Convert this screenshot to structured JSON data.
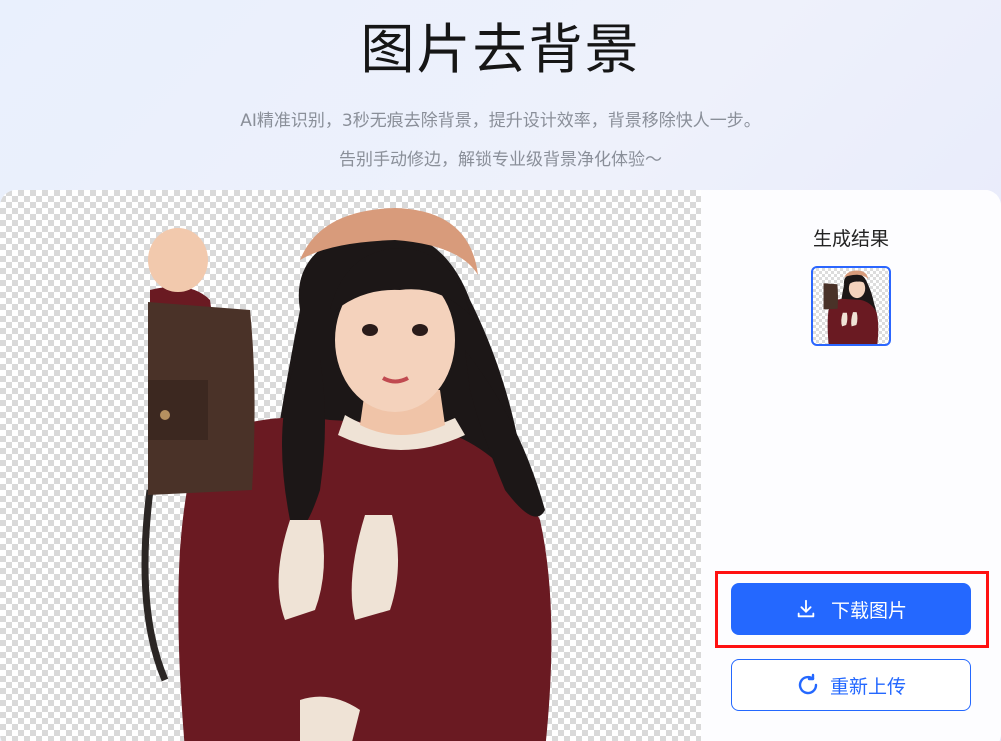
{
  "header": {
    "title": "图片去背景",
    "subtitle_line1": "AI精准识别，3秒无痕去除背景，提升设计效率，背景移除快人一步。",
    "subtitle_line2": "告别手动修边，解锁专业级背景净化体验～"
  },
  "sidebar": {
    "result_label": "生成结果",
    "download_label": "下载图片",
    "reupload_label": "重新上传"
  },
  "colors": {
    "accent": "#2468ff",
    "highlight_border": "#ff1111",
    "checker": "#d9d9d9"
  },
  "icons": {
    "download": "download-icon",
    "reupload": "refresh-icon"
  }
}
